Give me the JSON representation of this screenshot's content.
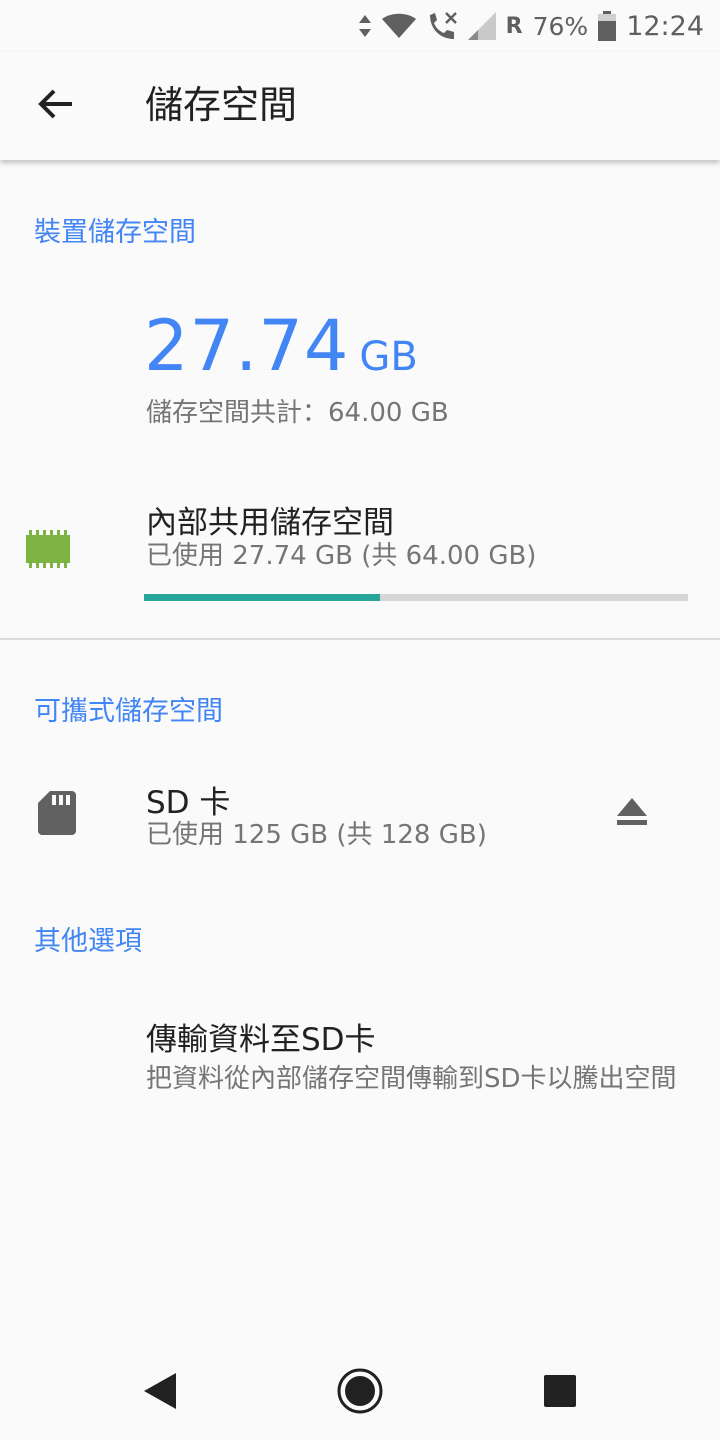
{
  "status_bar": {
    "roaming_label": "R",
    "battery_percent": "76%",
    "time": "12:24",
    "icons": [
      "data-arrows-icon",
      "wifi-icon",
      "call-icon",
      "signal-icon",
      "battery-icon"
    ]
  },
  "app_bar": {
    "title": "儲存空間",
    "back_icon": "arrow-back-icon"
  },
  "device_storage": {
    "header": "裝置儲存空間",
    "used_value": "27.74",
    "used_unit": "GB",
    "total_label": "儲存空間共計：64.00 GB",
    "internal": {
      "icon": "memory-chip-icon",
      "title": "內部共用儲存空間",
      "subtitle": "已使用 27.74 GB (共 64.00 GB)",
      "used_fraction": 0.4334
    }
  },
  "portable_storage": {
    "header": "可攜式儲存空間",
    "sd_card": {
      "icon": "sd-card-icon",
      "title": "SD 卡",
      "subtitle": "已使用 125 GB (共 128 GB)",
      "eject_icon": "eject-icon"
    }
  },
  "other_options": {
    "header": "其他選項",
    "transfer": {
      "title": "傳輸資料至SD卡",
      "subtitle": "把資料從內部儲存空間傳輸到SD卡以騰出空間"
    }
  },
  "nav_bar": {
    "icons": [
      "back-triangle-icon",
      "home-circle-icon",
      "recents-square-icon"
    ]
  },
  "colors": {
    "accent": "#4285f4",
    "progress": "#26a69a",
    "chip": "#7cb342",
    "secondary_text": "#757575"
  }
}
